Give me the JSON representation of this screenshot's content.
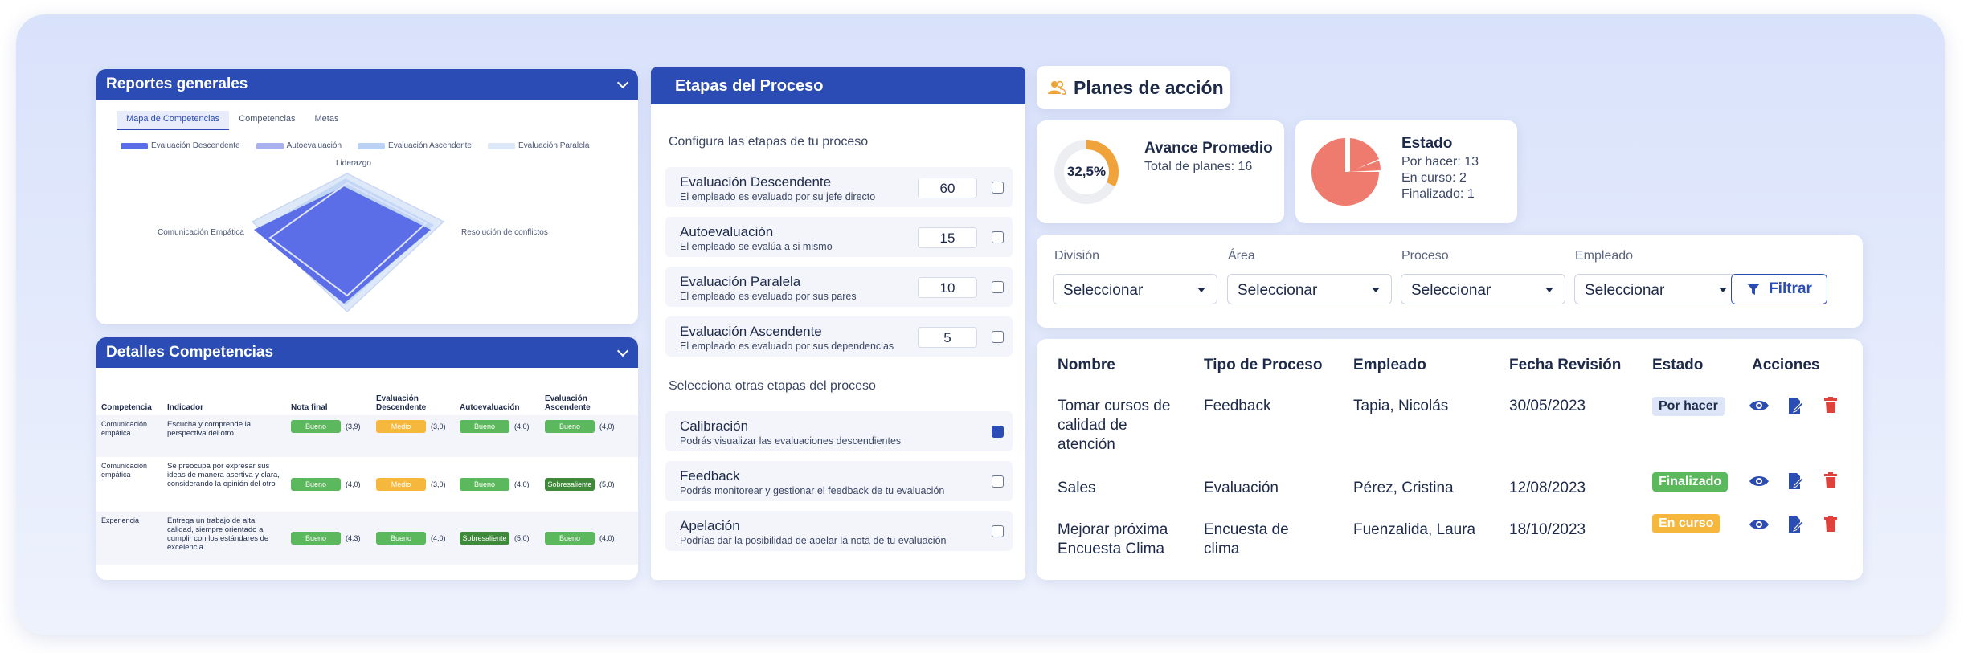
{
  "reportes": {
    "title": "Reportes generales",
    "tabs": [
      "Mapa de Competencias",
      "Competencias",
      "Metas"
    ],
    "legend": [
      {
        "label": "Evaluación Descendente",
        "color": "#5b6ee8"
      },
      {
        "label": "Autoevaluación",
        "color": "#a9b2ef"
      },
      {
        "label": "Evaluación Ascendente",
        "color": "#bcd2f5"
      },
      {
        "label": "Evaluación Paralela",
        "color": "#dde8f8"
      }
    ],
    "axes": {
      "top": "Liderazgo",
      "left": "Comunicación Empática",
      "right": "Resolución de conflictos"
    }
  },
  "detalles": {
    "title": "Detalles Competencias",
    "headers": [
      "Competencia",
      "Indicador",
      "Nota final",
      "Evaluación Descendente",
      "Autoevaluación",
      "Evaluación Ascendente"
    ],
    "rows": [
      {
        "competencia": "Comunicación empática",
        "indicador": "Escucha y comprende la perspectiva del otro",
        "cells": [
          {
            "label": "Bueno",
            "score": "(3,9)",
            "color": "green"
          },
          {
            "label": "Medio",
            "score": "(3,0)",
            "color": "orange"
          },
          {
            "label": "Bueno",
            "score": "(4,0)",
            "color": "green"
          },
          {
            "label": "Bueno",
            "score": "(4,0)",
            "color": "green"
          }
        ]
      },
      {
        "competencia": "Comunicación empática",
        "indicador": "Se preocupa por expresar sus ideas de manera asertiva y clara, considerando la opinión del otro",
        "cells": [
          {
            "label": "Bueno",
            "score": "(4,0)",
            "color": "green"
          },
          {
            "label": "Medio",
            "score": "(3,0)",
            "color": "orange"
          },
          {
            "label": "Bueno",
            "score": "(4,0)",
            "color": "green"
          },
          {
            "label": "Sobresaliente",
            "score": "(5,0)",
            "color": "dgreen"
          }
        ]
      },
      {
        "competencia": "Experiencia",
        "indicador": "Entrega un trabajo de alta calidad, siempre orientado a cumplir con los estándares de excelencia",
        "cells": [
          {
            "label": "Bueno",
            "score": "(4,3)",
            "color": "green"
          },
          {
            "label": "Bueno",
            "score": "(4,0)",
            "color": "green"
          },
          {
            "label": "Sobresaliente",
            "score": "(5,0)",
            "color": "dgreen"
          },
          {
            "label": "Bueno",
            "score": "(4,0)",
            "color": "green"
          }
        ]
      }
    ]
  },
  "etapas": {
    "title": "Etapas del Proceso",
    "configura": "Configura las etapas de tu proceso",
    "stages": [
      {
        "title": "Evaluación Descendente",
        "desc": "El empleado es evaluado por su jefe directo",
        "value": "60",
        "checked": false
      },
      {
        "title": "Autoevaluación",
        "desc": "El empleado se evalúa a si mismo",
        "value": "15",
        "checked": false
      },
      {
        "title": "Evaluación Paralela",
        "desc": "El empleado es evaluado por sus pares",
        "value": "10",
        "checked": false
      },
      {
        "title": "Evaluación Ascendente",
        "desc": "El empleado es evaluado por sus dependencias",
        "value": "5",
        "checked": false
      }
    ],
    "otras": "Selecciona otras etapas del proceso",
    "extra": [
      {
        "title": "Calibración",
        "desc": "Podrás visualizar las evaluaciones descendientes",
        "checked": true
      },
      {
        "title": "Feedback",
        "desc": "Podrás monitorear y gestionar el feedback de tu evaluación",
        "checked": false
      },
      {
        "title": "Apelación",
        "desc": "Podrías dar la posibilidad de apelar la nota de tu evaluación",
        "checked": false
      }
    ]
  },
  "planes": {
    "title": "Planes de acción",
    "avance": {
      "title": "Avance Promedio",
      "total": "Total de planes: 16",
      "percent_label": "32,5%",
      "percent": 32.5
    },
    "estado": {
      "title": "Estado",
      "por_hacer": "Por hacer: 13",
      "en_curso": "En curso: 2",
      "finalizado": "Finalizado: 1"
    },
    "filters": [
      {
        "label": "División",
        "value": "Seleccionar"
      },
      {
        "label": "Área",
        "value": "Seleccionar"
      },
      {
        "label": "Proceso",
        "value": "Seleccionar"
      },
      {
        "label": "Empleado",
        "value": "Seleccionar"
      }
    ],
    "filter_button": "Filtrar",
    "headers": [
      "Nombre",
      "Tipo de Proceso",
      "Empleado",
      "Fecha Revisión",
      "Estado",
      "Acciones"
    ],
    "rows": [
      {
        "nombre": "Tomar cursos de calidad de atención",
        "tipo": "Feedback",
        "empleado": "Tapia, Nicolás",
        "fecha": "30/05/2023",
        "estado": "Por hacer"
      },
      {
        "nombre": "Sales",
        "tipo": "Evaluación",
        "empleado": "Pérez, Cristina",
        "fecha": "12/08/2023",
        "estado": "Finalizado"
      },
      {
        "nombre": "Mejorar próxima Encuesta Clima",
        "tipo": "Encuesta de clima",
        "empleado": "Fuenzalida, Laura",
        "fecha": "18/10/2023",
        "estado": "En curso"
      }
    ],
    "colors": {
      "por_hacer_bg": "#dce6f8",
      "finalizado_bg": "#5cb85c",
      "en_curso_bg": "#f5b83d",
      "accent": "#2b4cb4",
      "delete": "#e0413a",
      "pie": "#ef7a6e",
      "donut": "#f0a23b"
    }
  }
}
